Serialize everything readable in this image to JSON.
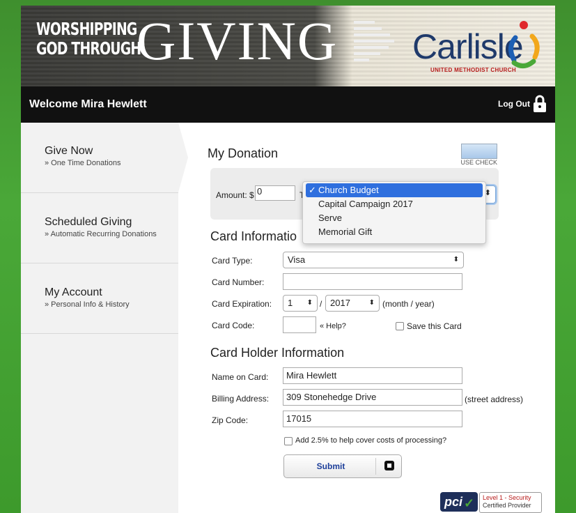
{
  "banner": {
    "line1": "WORSHIPPING",
    "line2": "GOD THROUGH",
    "big": "GIVING",
    "logo_name": "Carlisle",
    "logo_sub": "UNITED METHODIST CHURCH"
  },
  "topbar": {
    "welcome": "Welcome Mira Hewlett",
    "logout": "Log Out"
  },
  "sidebar": {
    "items": [
      {
        "title": "Give Now",
        "sub": "» One Time Donations"
      },
      {
        "title": "Scheduled Giving",
        "sub": "» Automatic Recurring Donations"
      },
      {
        "title": "My Account",
        "sub": "» Personal Info & History"
      }
    ]
  },
  "donation": {
    "heading": "My Donation",
    "use_check": "USE CHECK",
    "amount_label": "Amount: $",
    "amount_value": "0",
    "to_label": "T",
    "options": [
      "Church Budget",
      "Capital Campaign 2017",
      "Serve",
      "Memorial Gift"
    ],
    "selected_check": "✓"
  },
  "card": {
    "heading": "Card Informatio",
    "type_label": "Card Type:",
    "type_value": "Visa",
    "number_label": "Card Number:",
    "number_value": "",
    "exp_label": "Card Expiration:",
    "exp_month": "1",
    "exp_sep": "/",
    "exp_year": "2017",
    "exp_hint": "(month / year)",
    "code_label": "Card Code:",
    "code_value": "",
    "help": "« Help?",
    "save": "Save this Card"
  },
  "holder": {
    "heading": "Card Holder Information",
    "name_label": "Name on Card:",
    "name_value": "Mira Hewlett",
    "address_label": "Billing Address:",
    "address_value": "309 Stonehedge Drive",
    "address_hint": "(street address)",
    "zip_label": "Zip Code:",
    "zip_value": "17015",
    "fee_label": "Add 2.5% to help cover costs of processing?",
    "submit": "Submit"
  },
  "pci": {
    "logo": "pci",
    "line1": "Level 1 - Security",
    "line2": "Certified Provider"
  }
}
